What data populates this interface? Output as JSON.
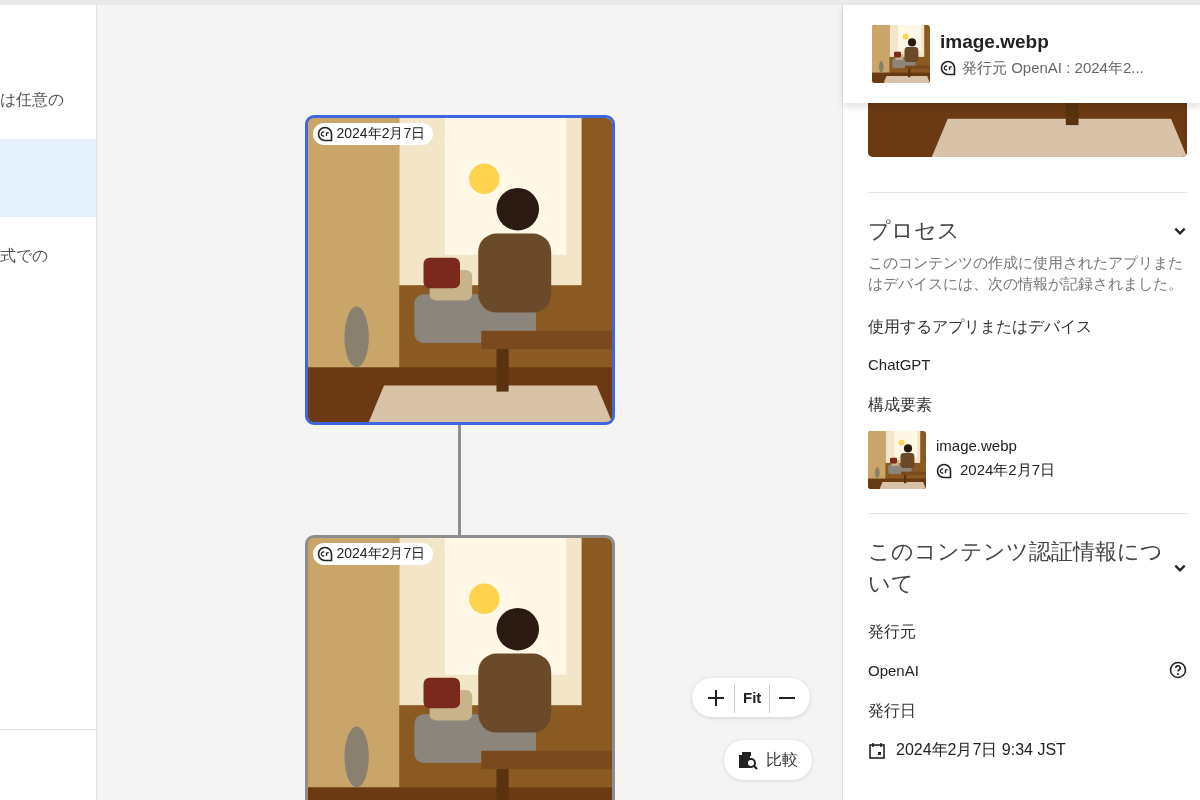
{
  "left_panel": {
    "items": [
      {
        "text": "は任意の",
        "selected": false
      },
      {
        "selected": true
      },
      {
        "text": "式での",
        "selected": false
      }
    ]
  },
  "canvas": {
    "nodes": [
      {
        "badge": "2024年2月7日",
        "selected": true
      },
      {
        "badge": "2024年2月7日",
        "selected": false
      }
    ],
    "zoom_controls": {
      "fit": "Fit"
    },
    "compare_button": "比較"
  },
  "details": {
    "header": {
      "title": "image.webp",
      "subtitle": "発行元 OpenAI : 2024年2..."
    },
    "process": {
      "title": "プロセス",
      "expanded": true,
      "description": "このコンテンツの作成に使用されたアプリまたはデバイスには、次の情報が記録されました。",
      "app_label": "使用するアプリまたはデバイス",
      "app_value": "ChatGPT",
      "ingredients_label": "構成要素",
      "ingredient": {
        "name": "image.webp",
        "date": "2024年2月7日"
      }
    },
    "about": {
      "title": "このコンテンツ認証情報について",
      "expanded": true,
      "issuer_label": "発行元",
      "issuer": "OpenAI",
      "date_label": "発行日",
      "date": "2024年2月7日 9:34 JST"
    }
  }
}
